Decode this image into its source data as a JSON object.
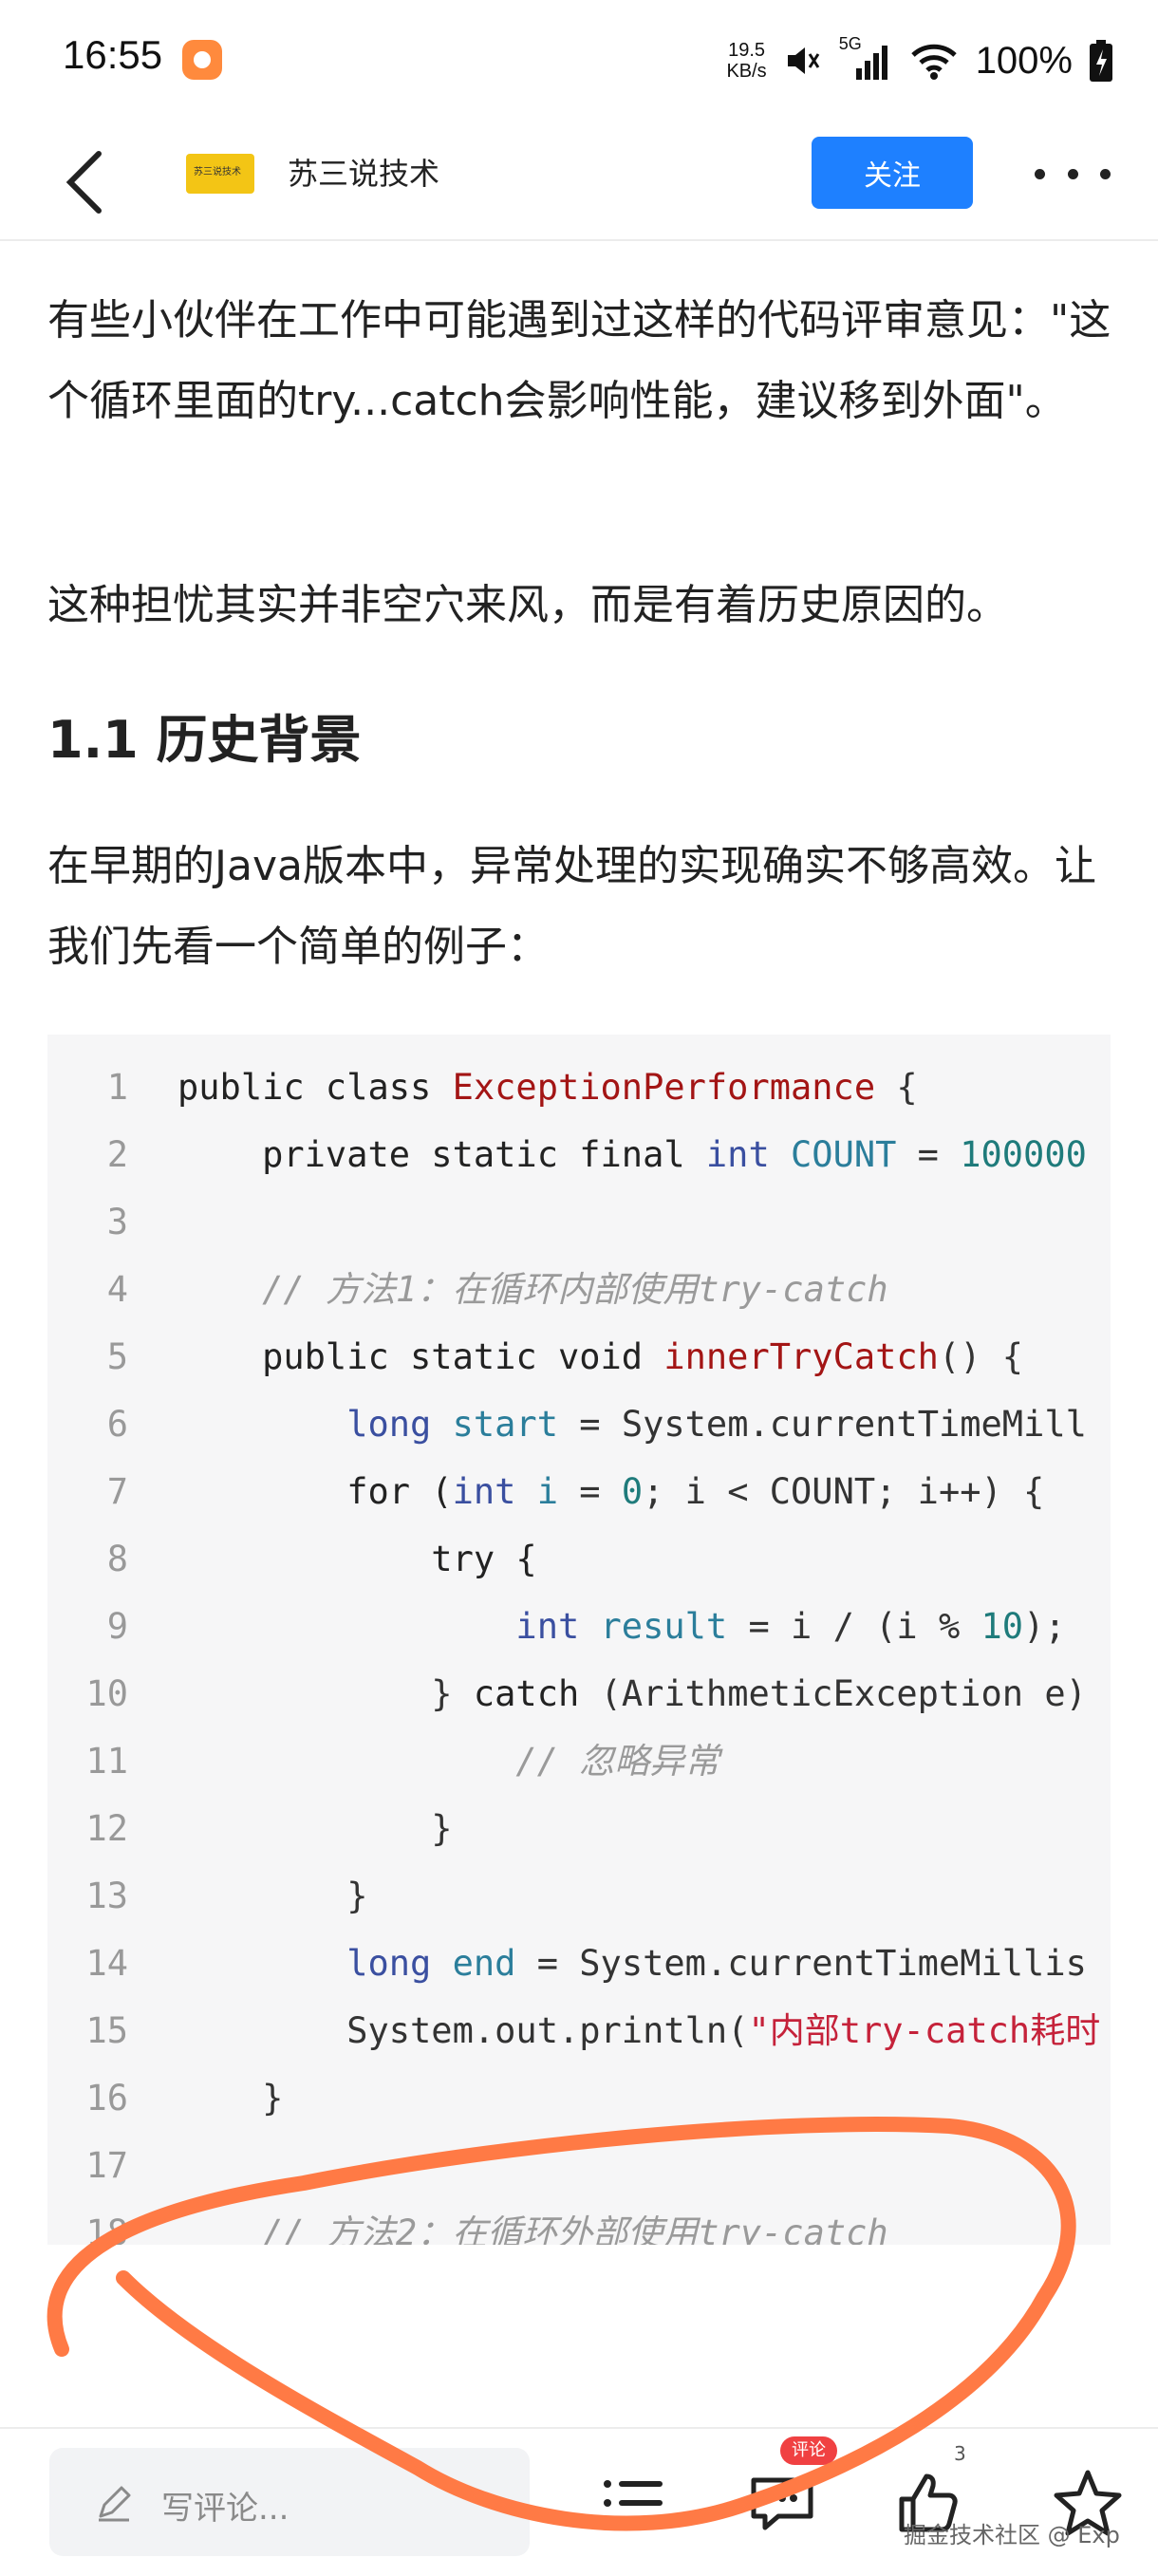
{
  "status_bar": {
    "time": "16:55",
    "net_speed_value": "19.5",
    "net_speed_unit": "KB/s",
    "network": "5G",
    "battery": "100%"
  },
  "header": {
    "logo_text": "苏三说技术",
    "channel_name": "苏三说技术",
    "follow_label": "关注",
    "accent_color": "#1e80ff"
  },
  "article": {
    "paragraphs": [
      "有些小伙伴在工作中可能遇到过这样的代码评审意见：\"这个循环里面的try...catch会影响性能，建议移到外面\"。",
      "这种担忧其实并非空穴来风，而是有着历史原因的。"
    ],
    "heading": "1.1 历史背景",
    "intro": "在早期的Java版本中，异常处理的实现确实不够高效。让我们先看一个简单的例子："
  },
  "code": {
    "line_numbers": [
      "1",
      "2",
      "3",
      "4",
      "5",
      "6",
      "7",
      "8",
      "9",
      "10",
      "11",
      "12",
      "13",
      "14",
      "15",
      "16",
      "17",
      "18"
    ],
    "l1": {
      "a": "public class ",
      "b": "ExceptionPerformance",
      "c": " {"
    },
    "l2": {
      "a": "    private static final ",
      "b": "int",
      "c": " ",
      "d": "COUNT",
      "e": " = ",
      "f": "100000"
    },
    "l4": "    // 方法1：在循环内部使用try-catch",
    "l5": {
      "a": "    public static void ",
      "b": "innerTryCatch",
      "c": "() {"
    },
    "l6": {
      "a": "        ",
      "b": "long",
      "c": " ",
      "d": "start",
      "e": " = System.currentTimeMill"
    },
    "l7": {
      "a": "        for (",
      "b": "int",
      "c": " ",
      "d": "i",
      "e": " = ",
      "f": "0",
      "g": "; i < COUNT; i++) {"
    },
    "l8": "            try {",
    "l9": {
      "a": "                ",
      "b": "int",
      "c": " ",
      "d": "result",
      "e": " = i / (i % ",
      "f": "10",
      "g": ");"
    },
    "l10": {
      "a": "            } ",
      "b": "catch",
      "c": " (ArithmeticException e)"
    },
    "l11": "                // 忽略异常",
    "l12": "            }",
    "l13": "        }",
    "l14": {
      "a": "        ",
      "b": "long",
      "c": " ",
      "d": "end",
      "e": " = System.currentTimeMillis"
    },
    "l15": {
      "a": "        System.out.println(",
      "b": "\"内部try-catch耗时"
    },
    "l16": "    }",
    "l18": "    // 方法2：在循环外部使用try-catch"
  },
  "bottom_bar": {
    "comment_placeholder": "写评论...",
    "comment_badge": "评论",
    "like_count": "3",
    "watermark": "掘金技术社区 @ Exp"
  },
  "icons": [
    "back-arrow-icon",
    "mute-icon",
    "signal-icon",
    "wifi-icon",
    "battery-charging-icon",
    "more-icon",
    "pencil-icon",
    "list-icon",
    "comment-icon",
    "thumbs-up-icon",
    "star-icon"
  ]
}
